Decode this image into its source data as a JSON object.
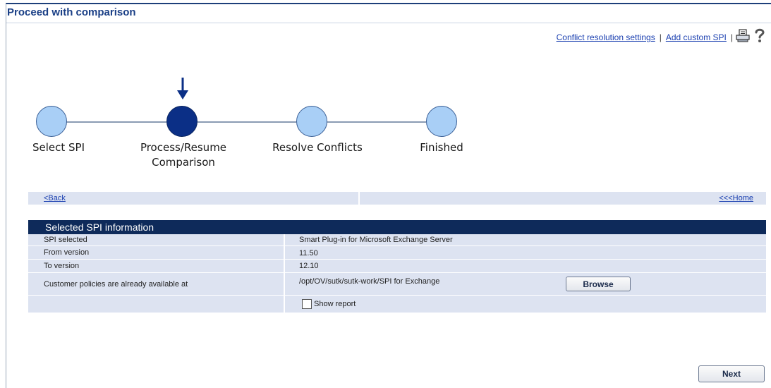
{
  "page": {
    "title": "Proceed with comparison"
  },
  "top_links": {
    "conflict_settings": "Conflict resolution settings",
    "separator": "|",
    "add_custom_spi": "Add custom SPI"
  },
  "wizard": {
    "steps": [
      {
        "label": "Select SPI",
        "active": false
      },
      {
        "label": "Process/Resume Comparison",
        "active": true
      },
      {
        "label": "Resolve Conflicts",
        "active": false
      },
      {
        "label": "Finished",
        "active": false
      }
    ]
  },
  "nav": {
    "back": "<Back",
    "home": "<<<Home"
  },
  "info": {
    "header": "Selected SPI information",
    "rows": [
      {
        "label": "SPI selected",
        "value": "Smart Plug-in for Microsoft Exchange Server"
      },
      {
        "label": "From version",
        "value": "11.50"
      },
      {
        "label": "To version",
        "value": "12.10"
      },
      {
        "label": "Customer policies are already available at",
        "value": "/opt/OV/sutk/sutk-work/SPI for Exchange"
      }
    ],
    "browse_label": "Browse",
    "show_report_label": "Show report",
    "show_report_checked": false
  },
  "actions": {
    "next_label": "Next"
  },
  "colors": {
    "accent": "#0e2a5a",
    "link": "#1a3fb0",
    "row_bg": "#dde3f1",
    "active_step": "#0b2f86",
    "step": "#a9cff6"
  }
}
